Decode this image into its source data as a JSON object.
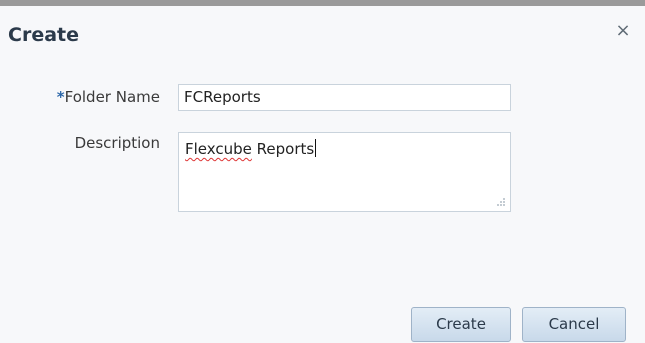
{
  "dialog": {
    "title": "Create",
    "close_symbol": "×"
  },
  "form": {
    "folder_name": {
      "required_marker": "*",
      "label": "Folder Name",
      "value": "FCReports"
    },
    "description": {
      "label": "Description",
      "value_word1": "Flexcube",
      "value_word2": " Reports"
    }
  },
  "actions": {
    "create_label": "Create",
    "cancel_label": "Cancel"
  },
  "colors": {
    "accent": "#2c67a8",
    "button_border": "#9fb3c8"
  },
  "icons": [
    "close-icon",
    "resize-grip-icon"
  ]
}
